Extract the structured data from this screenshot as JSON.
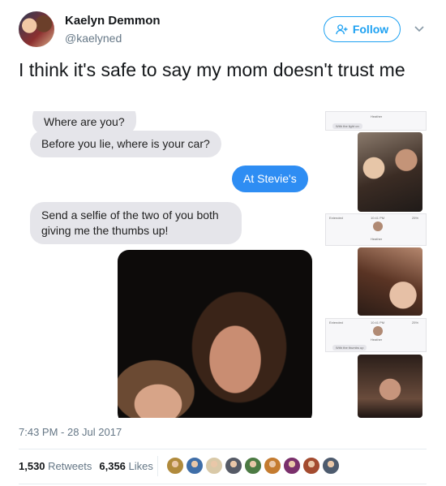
{
  "user": {
    "name": "Kaelyn Demmon",
    "handle": "@kaelyned",
    "follow_label": "Follow"
  },
  "tweet": {
    "text": "I think it's safe to say my mom doesn't trust me",
    "timestamp": "7:43 PM - 28 Jul 2017"
  },
  "messages": [
    {
      "from": "mom",
      "text": "Where are you?"
    },
    {
      "from": "mom",
      "text": "Before you lie, where is your car?"
    },
    {
      "from": "me",
      "text": "At Stevie's"
    },
    {
      "from": "mom",
      "text": "Send a selfie of the two of you both giving me the thumbs up!"
    }
  ],
  "thumbnails": {
    "contact_name": "Heather",
    "status_time": "10:41 PM",
    "carrier": "Extended",
    "battery": "25%",
    "caption_1": "With the light on",
    "caption_2": "With the thumbs up"
  },
  "stats": {
    "retweets_count": "1,530",
    "retweets_label": "Retweets",
    "likes_count": "6,356",
    "likes_label": "Likes"
  },
  "liker_colors": [
    "#b08a3c",
    "#3f6ea8",
    "#d9c9a8",
    "#555a66",
    "#4c7a43",
    "#c47b2f",
    "#7a2f6b",
    "#a34b2f",
    "#4d5b6e"
  ],
  "colors": {
    "accent": "#1da1f2",
    "imessage_blue": "#2e8df3",
    "bubble_gray": "#e5e5ea"
  }
}
